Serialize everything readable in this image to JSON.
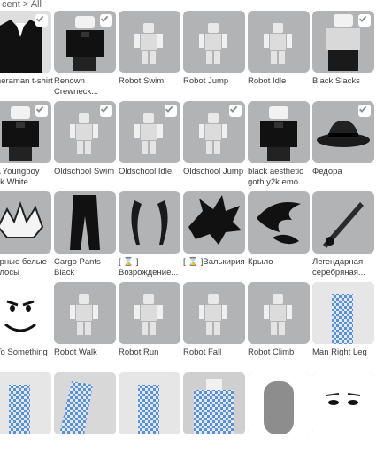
{
  "breadcrumb": "cent > All",
  "colors": {
    "tile_bg": "#b1b3b5",
    "check_bg": "#ffffff",
    "text": "#393b3d"
  },
  "items": [
    {
      "label": "ameraman t-shirt",
      "selected": true,
      "icon": "tshirt-icon"
    },
    {
      "label": "Renown Crewneck...",
      "selected": true,
      "icon": "shirt-avatar-icon"
    },
    {
      "label": "Robot Swim",
      "selected": false,
      "icon": "robot-figure-icon"
    },
    {
      "label": "Robot Jump",
      "selected": false,
      "icon": "robot-figure-icon"
    },
    {
      "label": "Robot Idle",
      "selected": false,
      "icon": "robot-figure-icon"
    },
    {
      "label": "Black Slacks",
      "selected": true,
      "icon": "pants-avatar-icon"
    },
    {
      "label": "BA Youngboy lack White...",
      "selected": true,
      "icon": "shirt-avatar-icon"
    },
    {
      "label": "Oldschool Swim",
      "selected": true,
      "icon": "robot-figure-icon"
    },
    {
      "label": "Oldschool Idle",
      "selected": true,
      "icon": "robot-figure-icon"
    },
    {
      "label": "Oldschool Jump",
      "selected": true,
      "icon": "robot-figure-icon"
    },
    {
      "label": "black aesthetic goth y2k emo...",
      "selected": false,
      "icon": "shirt-avatar-icon"
    },
    {
      "label": "Федора",
      "selected": true,
      "icon": "fedora-hat-icon"
    },
    {
      "label": "Чёрные белые Волосы",
      "selected": false,
      "icon": "hair-icon"
    },
    {
      "label": "Cargo Pants - Black",
      "selected": false,
      "icon": "cargo-pants-icon"
    },
    {
      "label": "[ ⌛ ] Возрождение...",
      "selected": false,
      "icon": "horns-icon"
    },
    {
      "label": "[ ⌛ ]Валькирия",
      "selected": false,
      "icon": "spiky-hair-icon"
    },
    {
      "label": "Крыло",
      "selected": false,
      "icon": "wing-icon"
    },
    {
      "label": "Легендарная серебряная...",
      "selected": false,
      "icon": "sword-icon"
    },
    {
      "label": "p To Something",
      "selected": false,
      "icon": "smile-face-icon"
    },
    {
      "label": "Robot Walk",
      "selected": false,
      "icon": "robot-figure-icon"
    },
    {
      "label": "Robot Run",
      "selected": false,
      "icon": "robot-figure-icon"
    },
    {
      "label": "Robot Fall",
      "selected": false,
      "icon": "robot-figure-icon"
    },
    {
      "label": "Robot Climb",
      "selected": false,
      "icon": "robot-figure-icon"
    },
    {
      "label": "Man Right Leg",
      "selected": false,
      "icon": "checkered-leg-icon"
    },
    {
      "label": "",
      "selected": false,
      "icon": "checkered-leg-icon"
    },
    {
      "label": "",
      "selected": false,
      "icon": "checkered-arm-icon"
    },
    {
      "label": "",
      "selected": false,
      "icon": "checkered-leg-icon"
    },
    {
      "label": "",
      "selected": false,
      "icon": "checkered-torso-icon"
    },
    {
      "label": "",
      "selected": false,
      "icon": "head-icon"
    },
    {
      "label": "",
      "selected": false,
      "icon": "face-icon"
    }
  ]
}
